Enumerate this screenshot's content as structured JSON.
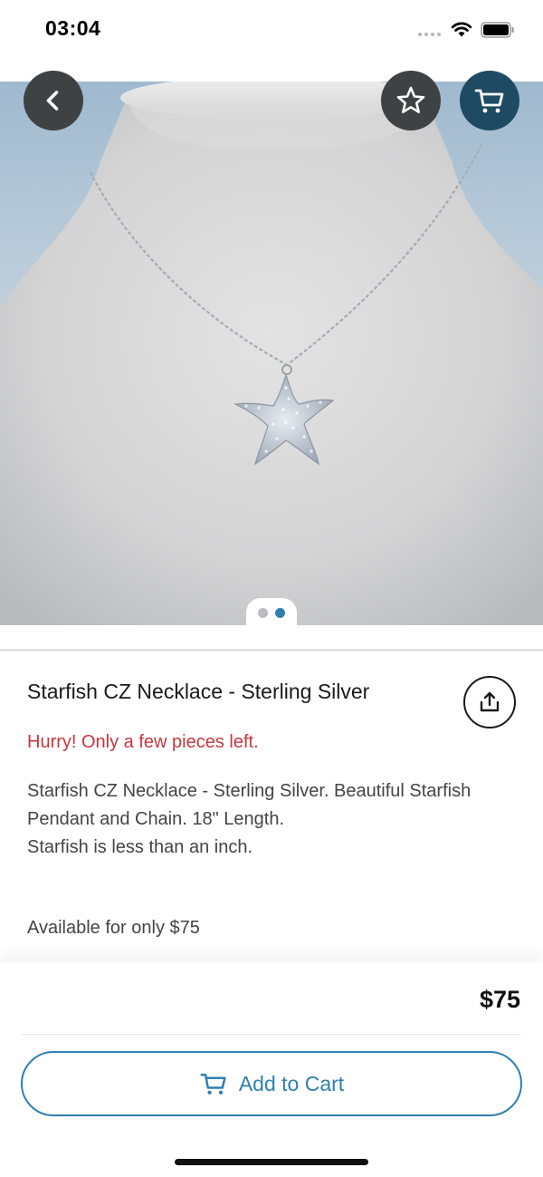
{
  "status_bar": {
    "time": "03:04"
  },
  "header": {
    "back_icon": "chevron-left-icon",
    "favorite_icon": "star-outline-icon",
    "cart_icon": "shopping-cart-icon"
  },
  "gallery": {
    "image_count": 2,
    "active_index": 1
  },
  "product": {
    "title": "Starfish CZ Necklace - Sterling Silver",
    "stock_note": "Hurry! Only a few pieces left.",
    "description": "Starfish CZ Necklace - Sterling Silver. Beautiful Starfish Pendant and Chain. 18\" Length.\nStarfish is less than an inch.",
    "availability": "Available for only $75",
    "share_icon": "share-icon"
  },
  "purchase": {
    "price": "$75",
    "add_to_cart_label": "Add to Cart",
    "add_to_cart_icon": "shopping-cart-icon"
  },
  "colors": {
    "accent": "#2f7fb3",
    "alert": "#c8373f",
    "dark_button": "#3f4244",
    "cart_button": "#1f4a63"
  }
}
